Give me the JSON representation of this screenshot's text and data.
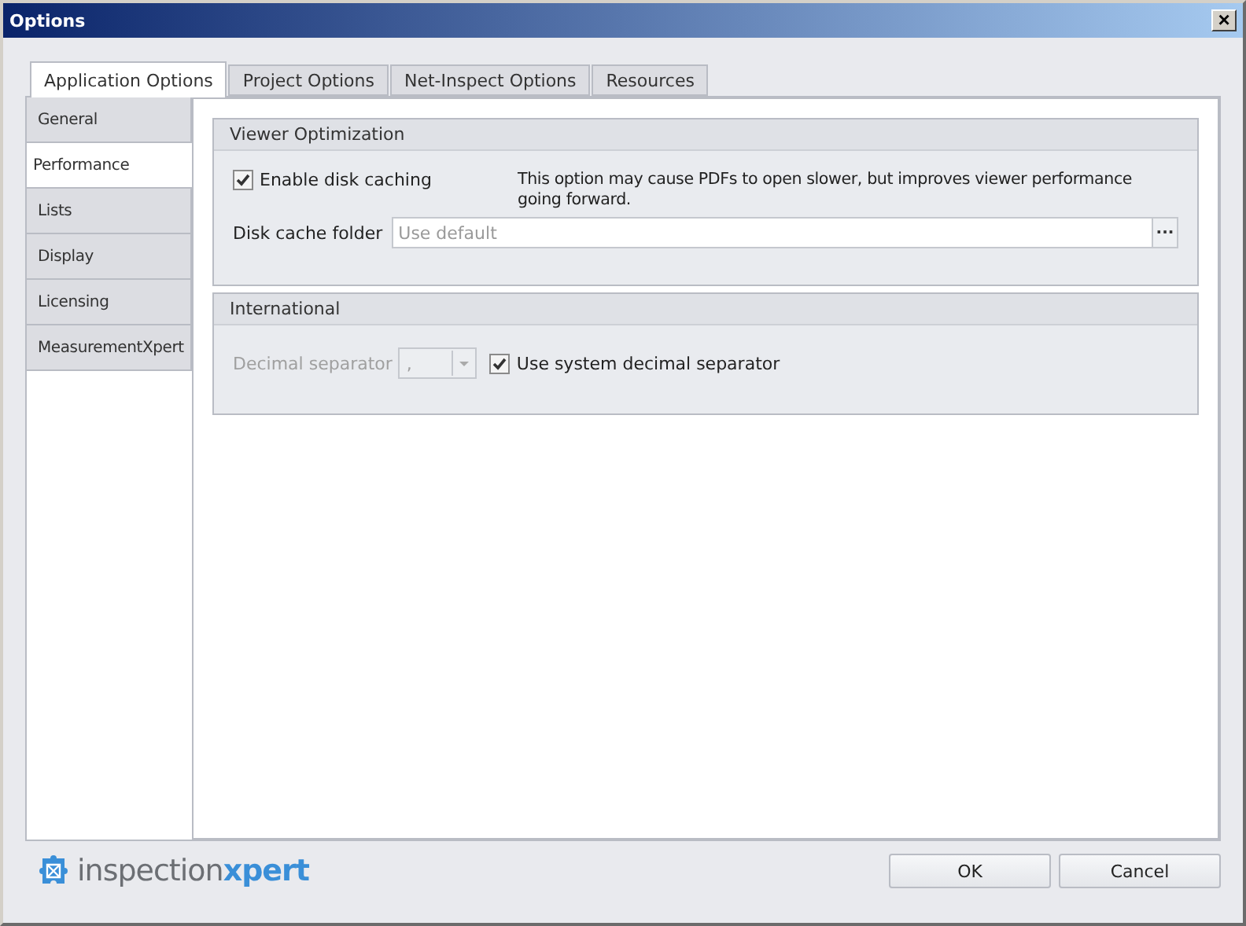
{
  "window": {
    "title": "Options",
    "close": "×"
  },
  "tabs": [
    {
      "label": "Application Options",
      "selected": true
    },
    {
      "label": "Project Options",
      "selected": false
    },
    {
      "label": "Net-Inspect Options",
      "selected": false
    },
    {
      "label": "Resources",
      "selected": false
    }
  ],
  "sidebar": {
    "items": [
      {
        "label": "General",
        "selected": false
      },
      {
        "label": "Performance",
        "selected": true
      },
      {
        "label": "Lists",
        "selected": false
      },
      {
        "label": "Display",
        "selected": false
      },
      {
        "label": "Licensing",
        "selected": false
      },
      {
        "label": "MeasurementXpert",
        "selected": false
      }
    ]
  },
  "viewer_optimization": {
    "title": "Viewer Optimization",
    "enable_disk_caching": {
      "label": "Enable disk caching",
      "checked": true
    },
    "note": "This option may cause PDFs to open slower, but improves viewer performance going forward.",
    "disk_cache_folder": {
      "label": "Disk cache folder",
      "placeholder": "Use default",
      "browse": "···"
    }
  },
  "international": {
    "title": "International",
    "decimal_separator": {
      "label": "Decimal separator",
      "value": ",",
      "disabled": true
    },
    "use_system": {
      "label": "Use system decimal separator",
      "checked": true
    }
  },
  "logo": {
    "prefix": "inspection",
    "suffix": "xpert"
  },
  "buttons": [
    "OK",
    "Cancel"
  ]
}
